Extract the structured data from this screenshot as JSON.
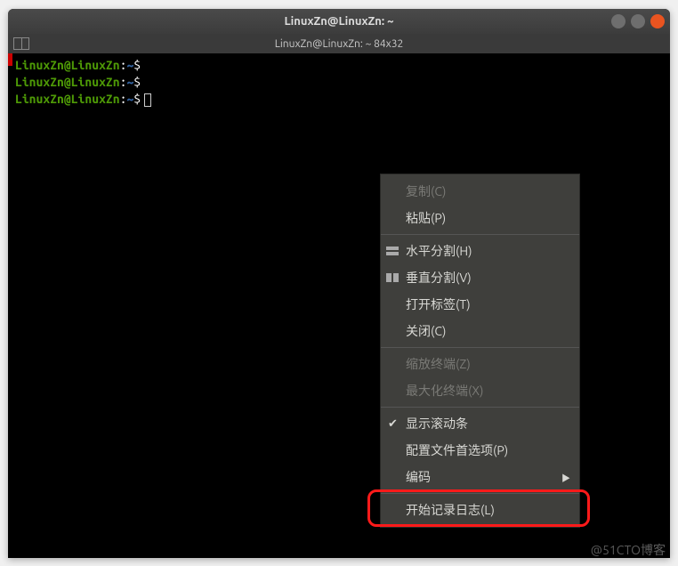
{
  "window": {
    "title": "LinuxZn@LinuxZn: ~",
    "subtitle": "LinuxZn@LinuxZn: ~ 84x32"
  },
  "prompt": {
    "user_host": "LinuxZn@LinuxZn",
    "colon": ":",
    "path": "~",
    "symbol": "$"
  },
  "menu": {
    "copy": "复制(C)",
    "paste": "粘贴(P)",
    "hsplit": "水平分割(H)",
    "vsplit": "垂直分割(V)",
    "open_tab": "打开标签(T)",
    "close": "关闭(C)",
    "zoom": "缩放终端(Z)",
    "maximize": "最大化终端(X)",
    "show_scrollbar": "显示滚动条",
    "preferences": "配置文件首选项(P)",
    "encoding": "编码",
    "start_log": "开始记录日志(L)"
  },
  "watermark": "@51CTO博客"
}
